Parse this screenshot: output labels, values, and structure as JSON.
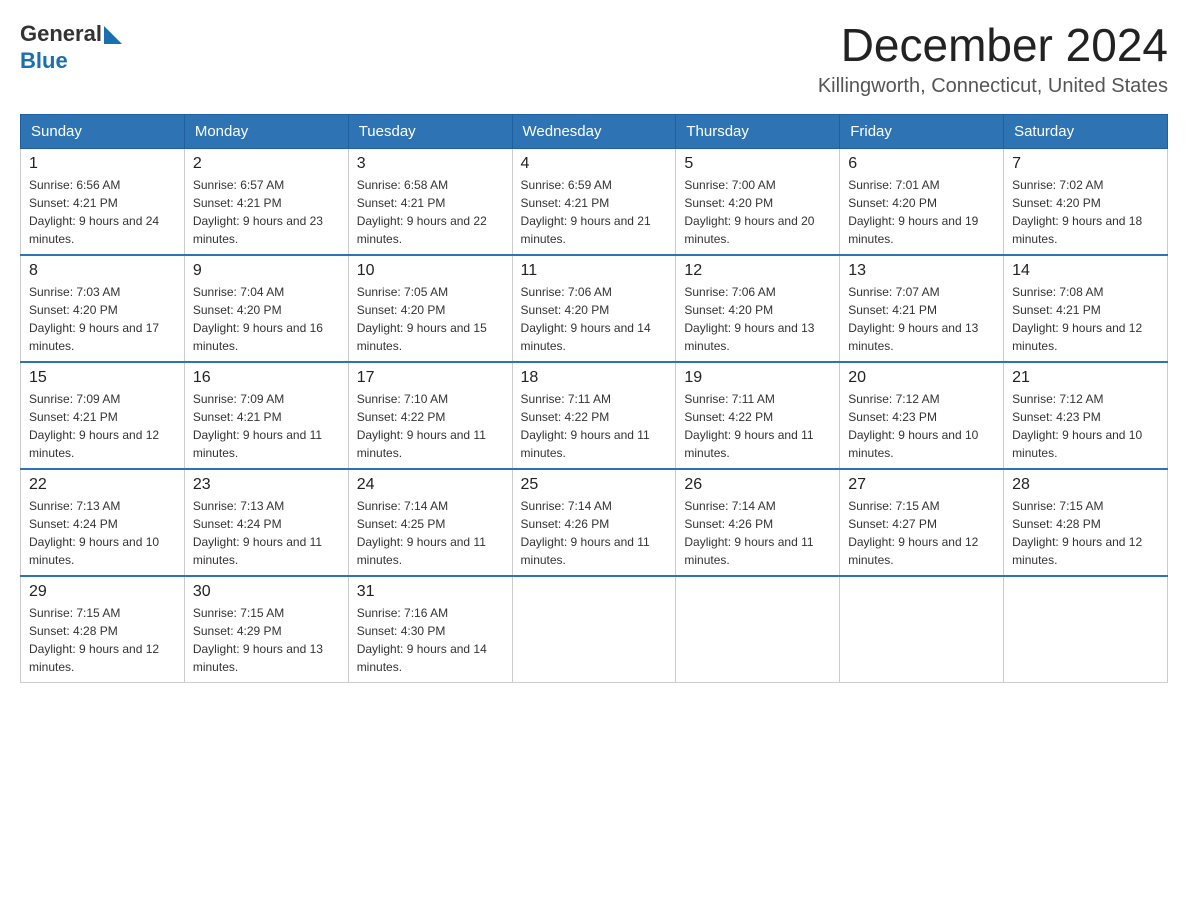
{
  "header": {
    "logo_general": "General",
    "logo_blue": "Blue",
    "title": "December 2024",
    "subtitle": "Killingworth, Connecticut, United States"
  },
  "weekdays": [
    "Sunday",
    "Monday",
    "Tuesday",
    "Wednesday",
    "Thursday",
    "Friday",
    "Saturday"
  ],
  "weeks": [
    [
      {
        "day": "1",
        "sunrise": "6:56 AM",
        "sunset": "4:21 PM",
        "daylight": "9 hours and 24 minutes."
      },
      {
        "day": "2",
        "sunrise": "6:57 AM",
        "sunset": "4:21 PM",
        "daylight": "9 hours and 23 minutes."
      },
      {
        "day": "3",
        "sunrise": "6:58 AM",
        "sunset": "4:21 PM",
        "daylight": "9 hours and 22 minutes."
      },
      {
        "day": "4",
        "sunrise": "6:59 AM",
        "sunset": "4:21 PM",
        "daylight": "9 hours and 21 minutes."
      },
      {
        "day": "5",
        "sunrise": "7:00 AM",
        "sunset": "4:20 PM",
        "daylight": "9 hours and 20 minutes."
      },
      {
        "day": "6",
        "sunrise": "7:01 AM",
        "sunset": "4:20 PM",
        "daylight": "9 hours and 19 minutes."
      },
      {
        "day": "7",
        "sunrise": "7:02 AM",
        "sunset": "4:20 PM",
        "daylight": "9 hours and 18 minutes."
      }
    ],
    [
      {
        "day": "8",
        "sunrise": "7:03 AM",
        "sunset": "4:20 PM",
        "daylight": "9 hours and 17 minutes."
      },
      {
        "day": "9",
        "sunrise": "7:04 AM",
        "sunset": "4:20 PM",
        "daylight": "9 hours and 16 minutes."
      },
      {
        "day": "10",
        "sunrise": "7:05 AM",
        "sunset": "4:20 PM",
        "daylight": "9 hours and 15 minutes."
      },
      {
        "day": "11",
        "sunrise": "7:06 AM",
        "sunset": "4:20 PM",
        "daylight": "9 hours and 14 minutes."
      },
      {
        "day": "12",
        "sunrise": "7:06 AM",
        "sunset": "4:20 PM",
        "daylight": "9 hours and 13 minutes."
      },
      {
        "day": "13",
        "sunrise": "7:07 AM",
        "sunset": "4:21 PM",
        "daylight": "9 hours and 13 minutes."
      },
      {
        "day": "14",
        "sunrise": "7:08 AM",
        "sunset": "4:21 PM",
        "daylight": "9 hours and 12 minutes."
      }
    ],
    [
      {
        "day": "15",
        "sunrise": "7:09 AM",
        "sunset": "4:21 PM",
        "daylight": "9 hours and 12 minutes."
      },
      {
        "day": "16",
        "sunrise": "7:09 AM",
        "sunset": "4:21 PM",
        "daylight": "9 hours and 11 minutes."
      },
      {
        "day": "17",
        "sunrise": "7:10 AM",
        "sunset": "4:22 PM",
        "daylight": "9 hours and 11 minutes."
      },
      {
        "day": "18",
        "sunrise": "7:11 AM",
        "sunset": "4:22 PM",
        "daylight": "9 hours and 11 minutes."
      },
      {
        "day": "19",
        "sunrise": "7:11 AM",
        "sunset": "4:22 PM",
        "daylight": "9 hours and 11 minutes."
      },
      {
        "day": "20",
        "sunrise": "7:12 AM",
        "sunset": "4:23 PM",
        "daylight": "9 hours and 10 minutes."
      },
      {
        "day": "21",
        "sunrise": "7:12 AM",
        "sunset": "4:23 PM",
        "daylight": "9 hours and 10 minutes."
      }
    ],
    [
      {
        "day": "22",
        "sunrise": "7:13 AM",
        "sunset": "4:24 PM",
        "daylight": "9 hours and 10 minutes."
      },
      {
        "day": "23",
        "sunrise": "7:13 AM",
        "sunset": "4:24 PM",
        "daylight": "9 hours and 11 minutes."
      },
      {
        "day": "24",
        "sunrise": "7:14 AM",
        "sunset": "4:25 PM",
        "daylight": "9 hours and 11 minutes."
      },
      {
        "day": "25",
        "sunrise": "7:14 AM",
        "sunset": "4:26 PM",
        "daylight": "9 hours and 11 minutes."
      },
      {
        "day": "26",
        "sunrise": "7:14 AM",
        "sunset": "4:26 PM",
        "daylight": "9 hours and 11 minutes."
      },
      {
        "day": "27",
        "sunrise": "7:15 AM",
        "sunset": "4:27 PM",
        "daylight": "9 hours and 12 minutes."
      },
      {
        "day": "28",
        "sunrise": "7:15 AM",
        "sunset": "4:28 PM",
        "daylight": "9 hours and 12 minutes."
      }
    ],
    [
      {
        "day": "29",
        "sunrise": "7:15 AM",
        "sunset": "4:28 PM",
        "daylight": "9 hours and 12 minutes."
      },
      {
        "day": "30",
        "sunrise": "7:15 AM",
        "sunset": "4:29 PM",
        "daylight": "9 hours and 13 minutes."
      },
      {
        "day": "31",
        "sunrise": "7:16 AM",
        "sunset": "4:30 PM",
        "daylight": "9 hours and 14 minutes."
      },
      null,
      null,
      null,
      null
    ]
  ]
}
